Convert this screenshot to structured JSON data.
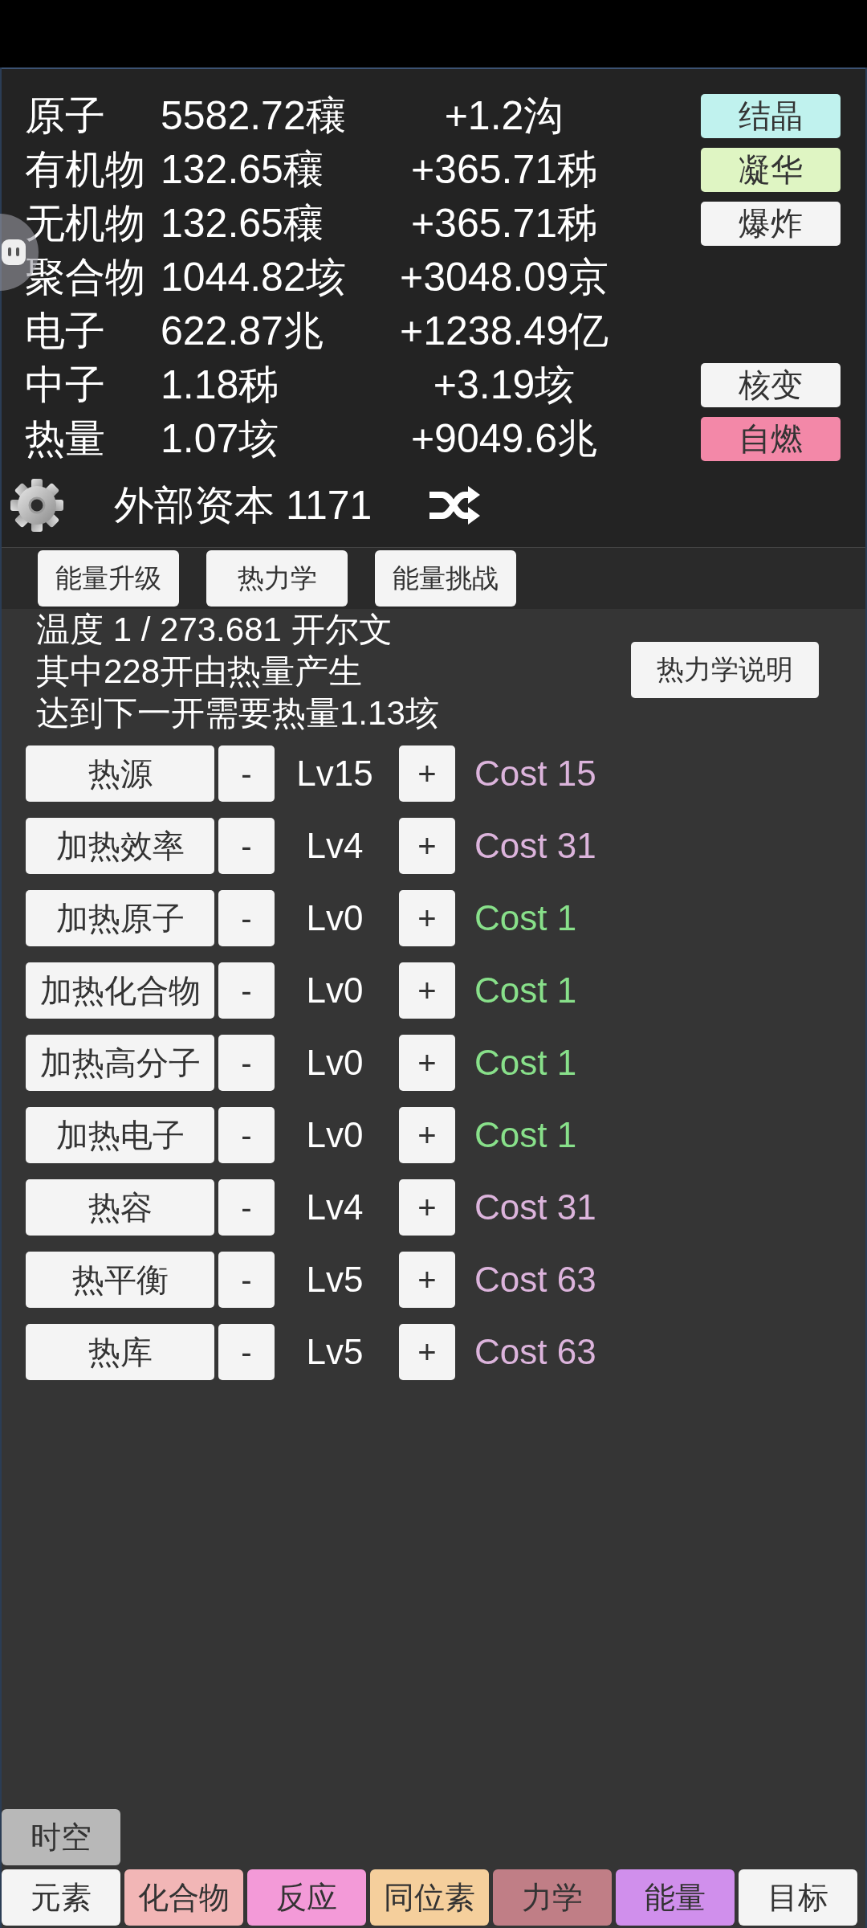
{
  "resources": [
    {
      "name": "原子",
      "amount": "5582.72穰",
      "rate": "+1.2沟",
      "action": {
        "label": "结晶",
        "color": "#c0f2ee"
      }
    },
    {
      "name": "有机物",
      "amount": "132.65穰",
      "rate": "+365.71秭",
      "action": {
        "label": "凝华",
        "color": "#dff5c3"
      }
    },
    {
      "name": "无机物",
      "amount": "132.65穰",
      "rate": "+365.71秭",
      "action": {
        "label": "爆炸",
        "color": "#f4f4f4"
      }
    },
    {
      "name": "聚合物",
      "amount": "1044.82垓",
      "rate": "+3048.09京"
    },
    {
      "name": "电子",
      "amount": "622.87兆",
      "rate": "+1238.49亿"
    },
    {
      "name": "中子",
      "amount": "1.18秭",
      "rate": "+3.19垓",
      "action": {
        "label": "核变",
        "color": "#f4f4f4"
      }
    },
    {
      "name": "热量",
      "amount": "1.07垓",
      "rate": "+9049.6兆",
      "action": {
        "label": "自燃",
        "color": "#f388a8"
      }
    }
  ],
  "capital": {
    "label": "外部资本 1171"
  },
  "sub_tabs": [
    {
      "label": "能量升级"
    },
    {
      "label": "热力学"
    },
    {
      "label": "能量挑战"
    }
  ],
  "thermo": {
    "lines": [
      "温度 1 / 273.681 开尔文",
      "其中228开由热量产生",
      "达到下一开需要热量1.13垓"
    ],
    "help_button": "热力学说明"
  },
  "upgrades": [
    {
      "name": "热源",
      "minus": "-",
      "level_label": "Lv15",
      "plus": "+",
      "cost": "Cost 15",
      "color": "#dcb4dc"
    },
    {
      "name": "加热效率",
      "minus": "-",
      "level_label": "Lv4",
      "plus": "+",
      "cost": "Cost 31",
      "color": "#dcb4dc"
    },
    {
      "name": "加热原子",
      "minus": "-",
      "level_label": "Lv0",
      "plus": "+",
      "cost": "Cost 1",
      "color": "#88e08a"
    },
    {
      "name": "加热化合物",
      "minus": "-",
      "level_label": "Lv0",
      "plus": "+",
      "cost": "Cost 1",
      "color": "#88e08a"
    },
    {
      "name": "加热高分子",
      "minus": "-",
      "level_label": "Lv0",
      "plus": "+",
      "cost": "Cost 1",
      "color": "#88e08a"
    },
    {
      "name": "加热电子",
      "minus": "-",
      "level_label": "Lv0",
      "plus": "+",
      "cost": "Cost 1",
      "color": "#88e08a"
    },
    {
      "name": "热容",
      "minus": "-",
      "level_label": "Lv4",
      "plus": "+",
      "cost": "Cost 31",
      "color": "#dcb4dc"
    },
    {
      "name": "热平衡",
      "minus": "-",
      "level_label": "Lv5",
      "plus": "+",
      "cost": "Cost 63",
      "color": "#dcb4dc"
    },
    {
      "name": "热库",
      "minus": "-",
      "level_label": "Lv5",
      "plus": "+",
      "cost": "Cost 63",
      "color": "#dcb4dc"
    }
  ],
  "spacetime_button": {
    "label": "时空"
  },
  "nav_tabs": [
    {
      "label": "元素",
      "color": "#f4f4f4"
    },
    {
      "label": "化合物",
      "color": "#f2b6b6"
    },
    {
      "label": "反应",
      "color": "#f39ad8"
    },
    {
      "label": "同位素",
      "color": "#f5cf9c"
    },
    {
      "label": "力学",
      "color": "#c07e86"
    },
    {
      "label": "能量",
      "color": "#d08fec"
    },
    {
      "label": "目标",
      "color": "#f4f4f4"
    }
  ]
}
